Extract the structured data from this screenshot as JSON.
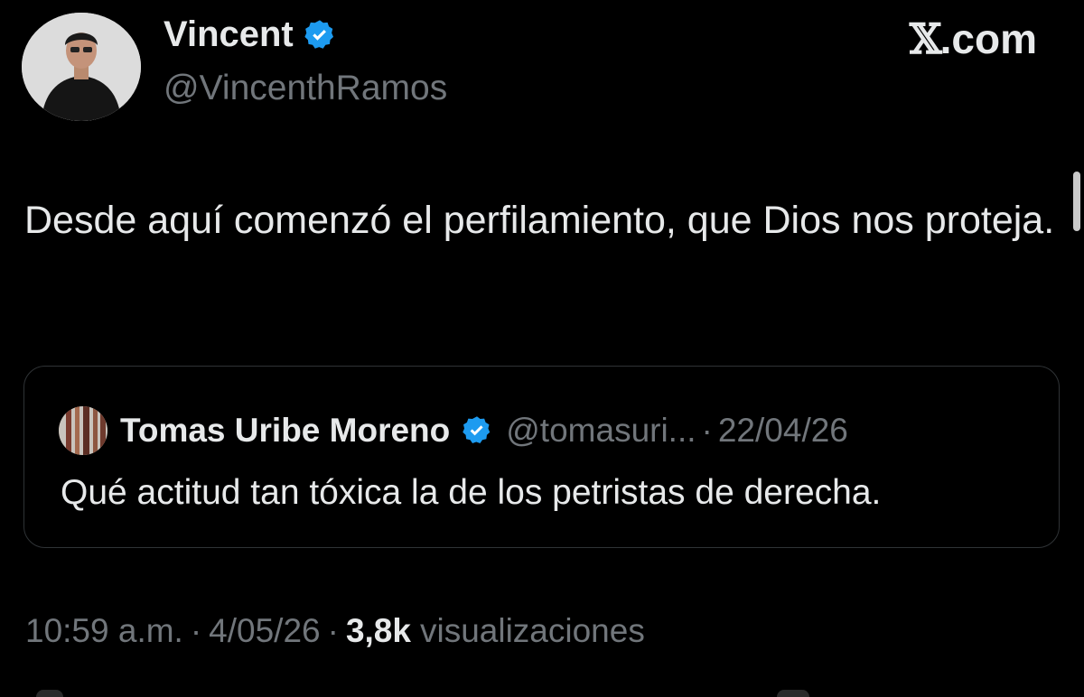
{
  "author": {
    "display_name": "Vincent",
    "handle": "@VincenthRamos",
    "verified_icon": "verified-badge-icon",
    "avatar_icon": "avatar-photo"
  },
  "brand": {
    "x_glyph": "𝕏",
    "suffix": ".com"
  },
  "tweet": {
    "text": "Desde aquí comenzó el perfilamiento, que Dios nos proteja."
  },
  "quote": {
    "display_name": "Tomas Uribe Moreno",
    "handle": "@tomasuri...",
    "separator": "·",
    "date": "22/04/26",
    "text": "Qué actitud tan tóxica la de los petristas de derecha."
  },
  "meta": {
    "time": "10:59 a.m.",
    "separator": "·",
    "date": "4/05/26",
    "views_count": "3,8k",
    "views_label": "visualizaciones"
  },
  "colors": {
    "background": "#000000",
    "primary_text": "#e7e9ea",
    "secondary_text": "#71767b",
    "verified_blue": "#1d9bf0",
    "border": "#2f3336"
  }
}
